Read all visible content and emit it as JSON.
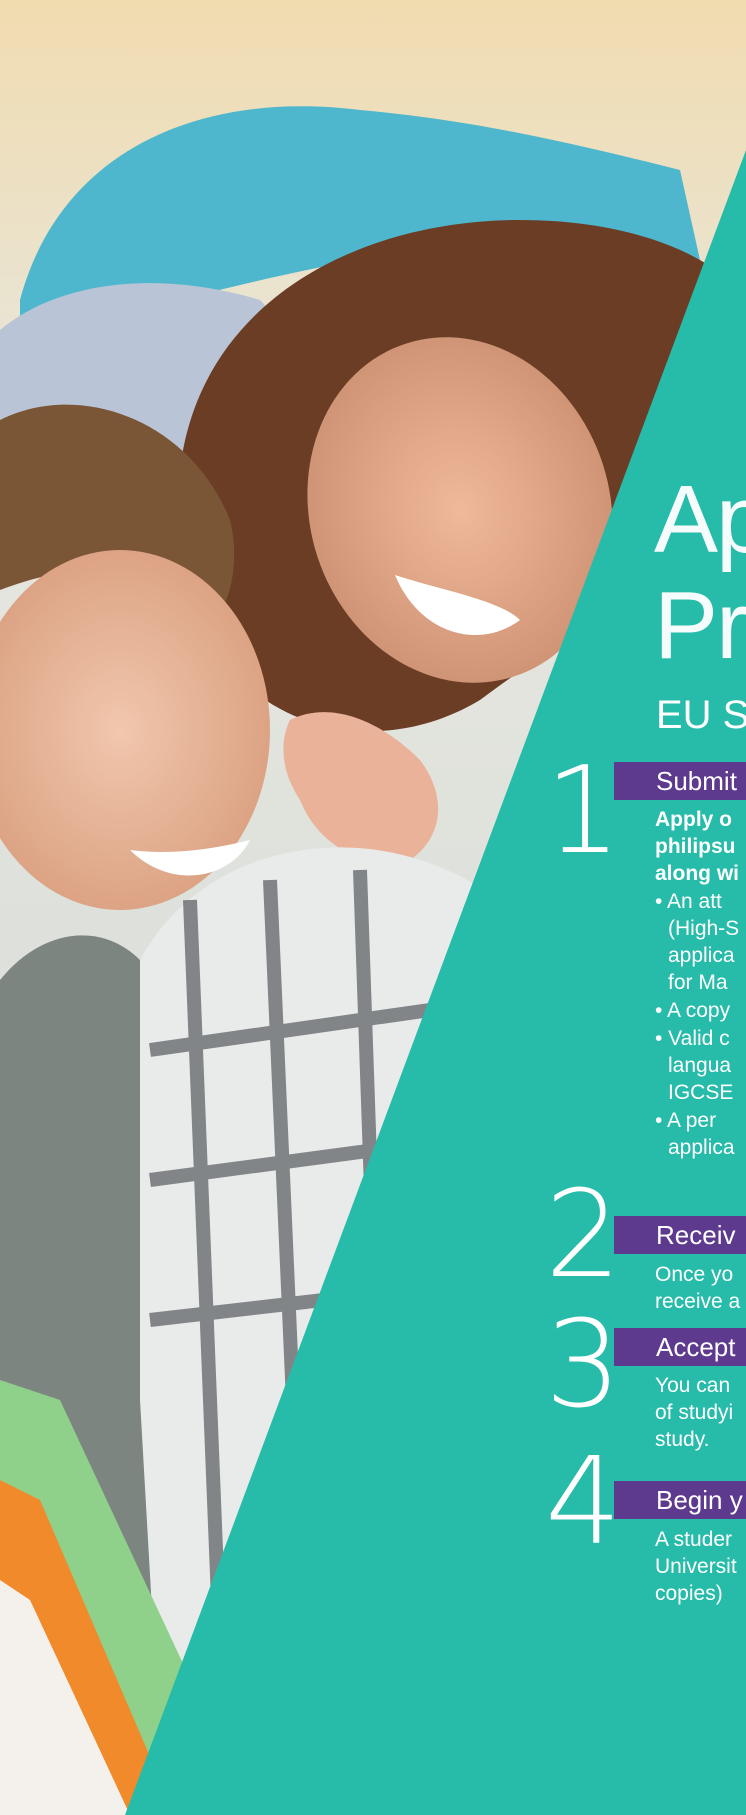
{
  "title": {
    "line1": "Ap",
    "line2": "Pr"
  },
  "subtitle": "EU S",
  "steps": [
    {
      "number": "1",
      "heading": "Submit",
      "intro": [
        "Apply o",
        "philipsu",
        "along wi"
      ],
      "bullets": [
        [
          "• An att",
          "(High-S",
          "applica",
          "for Ma"
        ],
        [
          "• A copy"
        ],
        [
          "• Valid c",
          "langua",
          "IGCSE"
        ],
        [
          "• A per",
          "applica"
        ]
      ]
    },
    {
      "number": "2",
      "heading": "Receiv",
      "body": [
        "Once yo",
        "receive a"
      ]
    },
    {
      "number": "3",
      "heading": "Accept",
      "body": [
        "You can",
        "of studyi",
        "study."
      ]
    },
    {
      "number": "4",
      "heading": "Begin y",
      "body": [
        "A studer",
        "Universit",
        "copies)"
      ]
    }
  ],
  "colors": {
    "teal": "#27bca9",
    "purple": "#5d3a8e",
    "sky": "#f3e8d0",
    "shirt": "#7d8580"
  }
}
